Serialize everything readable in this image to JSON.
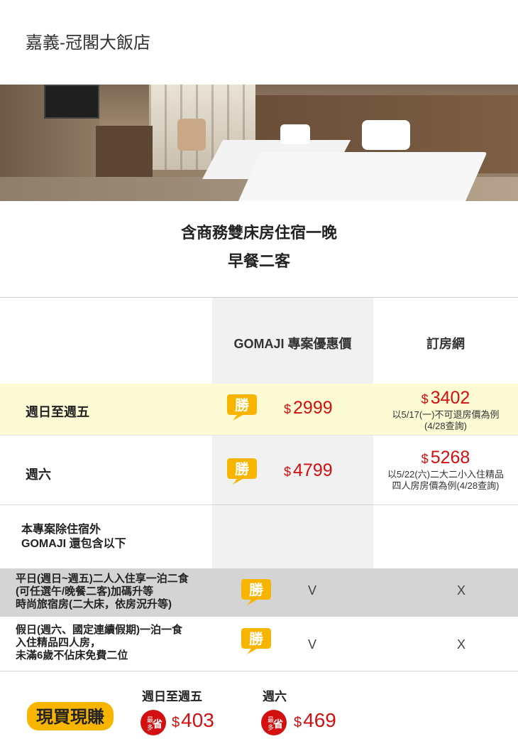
{
  "hotel": {
    "name": "嘉義-冠閣大飯店"
  },
  "offer": {
    "line1": "含商務雙床房住宿一晚",
    "line2": "早餐二客"
  },
  "table": {
    "header_gomaji": "GOMAJI 專案優惠價",
    "header_booking": "訂房網",
    "win_badge_text": "勝",
    "rows": [
      {
        "label": "週日至週五",
        "gomaji_symbol": "$",
        "gomaji_price": "2999",
        "booking_symbol": "$",
        "booking_price": "3402",
        "booking_note_1": "以5/17(一)不可退房價為例",
        "booking_note_2": "(4/28查詢)"
      },
      {
        "label": "週六",
        "gomaji_symbol": "$",
        "gomaji_price": "4799",
        "booking_symbol": "$",
        "booking_price": "5268",
        "booking_note_1": "以5/22(六)二大二小入住精品",
        "booking_note_2": "四人房房價為例(4/28查詢)"
      }
    ],
    "extra_label_1": "本專案除住宿外",
    "extra_label_2": "GOMAJI 還包含以下",
    "features": [
      {
        "line1": "平日(週日~週五)二人入住享一泊二食",
        "line2": "(可任選午/晚餐二客)加碼升等",
        "line3": "時尚旅宿房(二大床，依房況升等)",
        "gomaji_mark": "V",
        "booking_mark": "X"
      },
      {
        "line1": "假日(週六、國定連續假期)一泊一食",
        "line2": "入住精品四人房，",
        "line3": "未滿6歲不佔床免費二位",
        "gomaji_mark": "V",
        "booking_mark": "X"
      }
    ]
  },
  "savings": {
    "logo_text": "現買現賺",
    "badge_text_1": "最",
    "badge_text_2": "多",
    "badge_text_3": "省",
    "items": [
      {
        "title": "週日至週五",
        "symbol": "$",
        "amount": "403"
      },
      {
        "title": "週六",
        "symbol": "$",
        "amount": "469"
      }
    ]
  },
  "colors": {
    "accent_red": "#d40f0f",
    "highlight_yellow": "#fdfbd4",
    "badge_yellow": "#f7b500",
    "feature_gray": "#d4d4d4"
  }
}
